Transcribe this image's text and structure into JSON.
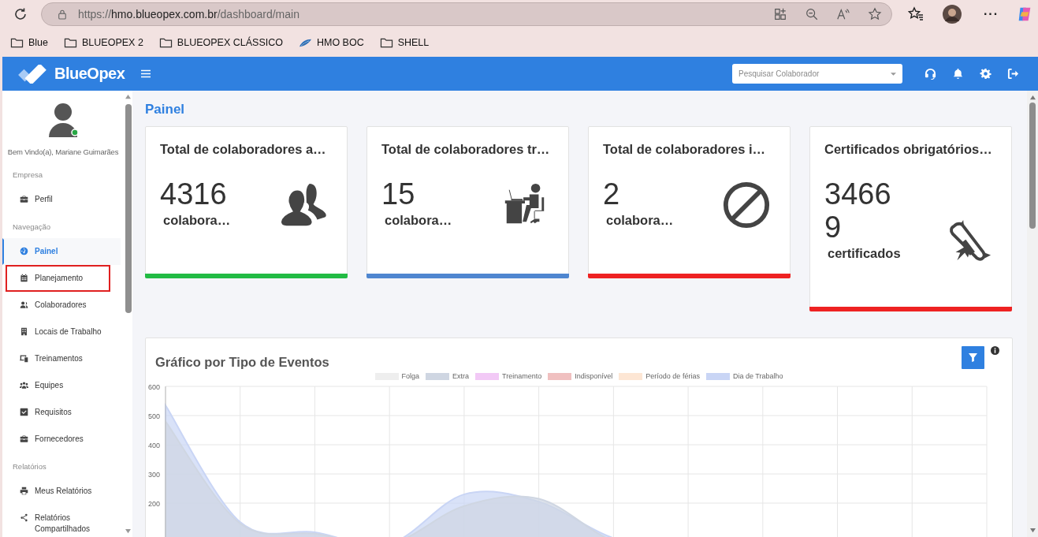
{
  "browser": {
    "url_scheme": "https://",
    "url_host": "hmo.blueopex.com.br",
    "url_path": "/dashboard/main",
    "more": "···",
    "bookmarks": [
      {
        "label": "Blue",
        "kind": "folder"
      },
      {
        "label": "BLUEOPEX 2",
        "kind": "folder"
      },
      {
        "label": "BLUEOPEX CLÁSSICO",
        "kind": "folder"
      },
      {
        "label": "HMO BOC",
        "kind": "site"
      },
      {
        "label": "SHELL",
        "kind": "folder"
      }
    ]
  },
  "header": {
    "brand": "BlueOpex",
    "search": {
      "placeholder": "Pesquisar Colaborador"
    }
  },
  "sidebar": {
    "user": {
      "greeting": "Bem Vindo(a), Mariane Guimarães",
      "online": true
    },
    "sections": [
      {
        "title": "Empresa",
        "items": [
          {
            "label": "Perfil",
            "selected": false,
            "outlined": false
          }
        ]
      },
      {
        "title": "Navegação",
        "items": [
          {
            "label": "Painel",
            "selected": true,
            "outlined": false
          },
          {
            "label": "Planejamento",
            "selected": false,
            "outlined": true
          },
          {
            "label": "Colaboradores",
            "selected": false,
            "outlined": false
          },
          {
            "label": "Locais de Trabalho",
            "selected": false,
            "outlined": false
          },
          {
            "label": "Treinamentos",
            "selected": false,
            "outlined": false
          },
          {
            "label": "Equipes",
            "selected": false,
            "outlined": false
          },
          {
            "label": "Requisitos",
            "selected": false,
            "outlined": false
          },
          {
            "label": "Fornecedores",
            "selected": false,
            "outlined": false
          }
        ]
      },
      {
        "title": "Relatórios",
        "items": [
          {
            "label": "Meus Relatórios",
            "selected": false,
            "outlined": false
          },
          {
            "label": "Relatórios Compartilhados",
            "selected": false,
            "outlined": false
          }
        ]
      }
    ]
  },
  "page_title": "Painel",
  "cards": [
    {
      "title": "Total de colaboradores a…",
      "value_lines": [
        "4316"
      ],
      "unit": "colabora…",
      "color": "#22bb44"
    },
    {
      "title": "Total de colaboradores tr…",
      "value_lines": [
        "15"
      ],
      "unit": "colabora…",
      "color": "#4f86d0"
    },
    {
      "title": "Total de colaboradores i…",
      "value_lines": [
        "2"
      ],
      "unit": "colabora…",
      "color": "#ee2222"
    },
    {
      "title": "Certificados obrigatórios…",
      "value_lines": [
        "3466",
        "9"
      ],
      "unit": "certificados",
      "color": "#ee2222"
    }
  ],
  "chart_card": {
    "title": "Gráfico por Tipo de Eventos",
    "chart_data": {
      "type": "area",
      "grid": true,
      "ylim": [
        0,
        600
      ],
      "yticks": [
        200,
        300,
        400,
        500,
        600
      ],
      "series": [
        {
          "name": "Folga",
          "color": "#eeeeee"
        },
        {
          "name": "Extra",
          "color": "#cfd6e2",
          "values": [
            480,
            130,
            95,
            60,
            190,
            215,
            70,
            30,
            15,
            5,
            0,
            0
          ]
        },
        {
          "name": "Treinamento",
          "color": "#f2c9f6"
        },
        {
          "name": "Indisponível",
          "color": "#f0c0c0"
        },
        {
          "name": "Período de férias",
          "color": "#fde6d4"
        },
        {
          "name": "Dia de Trabalho",
          "color": "#c9d5f5",
          "values": [
            535,
            135,
            100,
            60,
            230,
            205,
            80,
            40,
            20,
            10,
            5,
            0
          ]
        }
      ]
    }
  }
}
